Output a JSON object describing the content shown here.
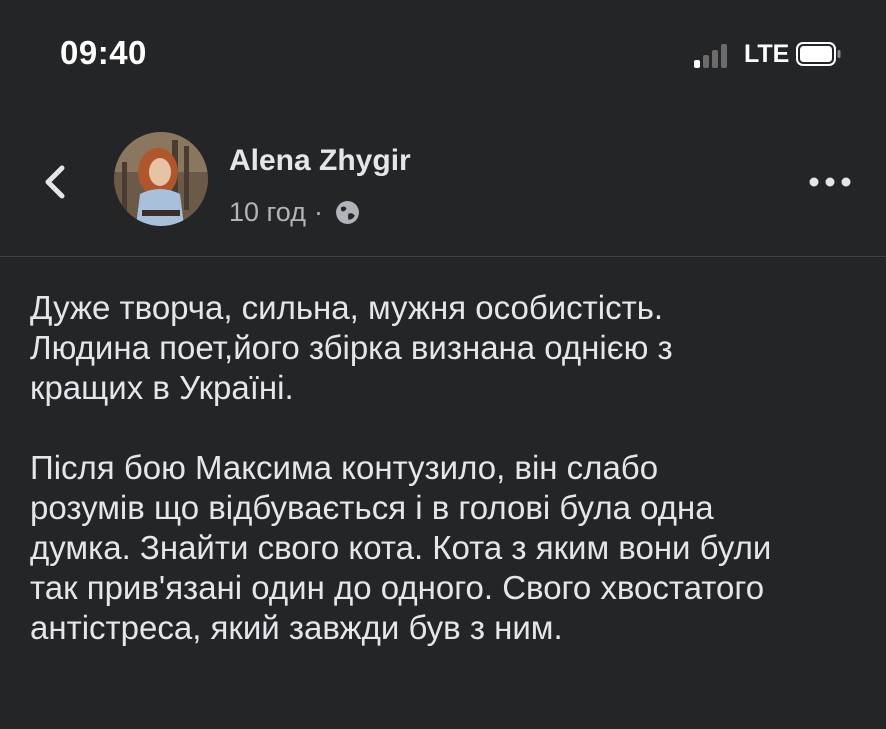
{
  "status_bar": {
    "time": "09:40",
    "network": "LTE",
    "icons": [
      "signal-icon",
      "battery-icon"
    ]
  },
  "post": {
    "author": "Alena Zhygir",
    "time_ago": "10 год",
    "separator": "·",
    "icons": [
      "back-arrow-icon",
      "globe-icon",
      "more-icon"
    ],
    "paragraphs": [
      "Дуже творча, сильна, мужня особистість.\nЛюдина поет,його збірка визнана однією з\nкращих в Україні.",
      "Після бою Максима контузило, він слабо\nрозумів що відбувається і в голові була одна\nдумка. Знайти свого кота. Кота з яким вони були\nтак прив'язані один до одного. Свого хвостатого\nантістреса, який завжди був з ним."
    ]
  },
  "colors": {
    "background": "#242526",
    "primary_text": "#e4e6eb",
    "secondary_text": "#b0b3b8",
    "divider": "#3e4042"
  }
}
